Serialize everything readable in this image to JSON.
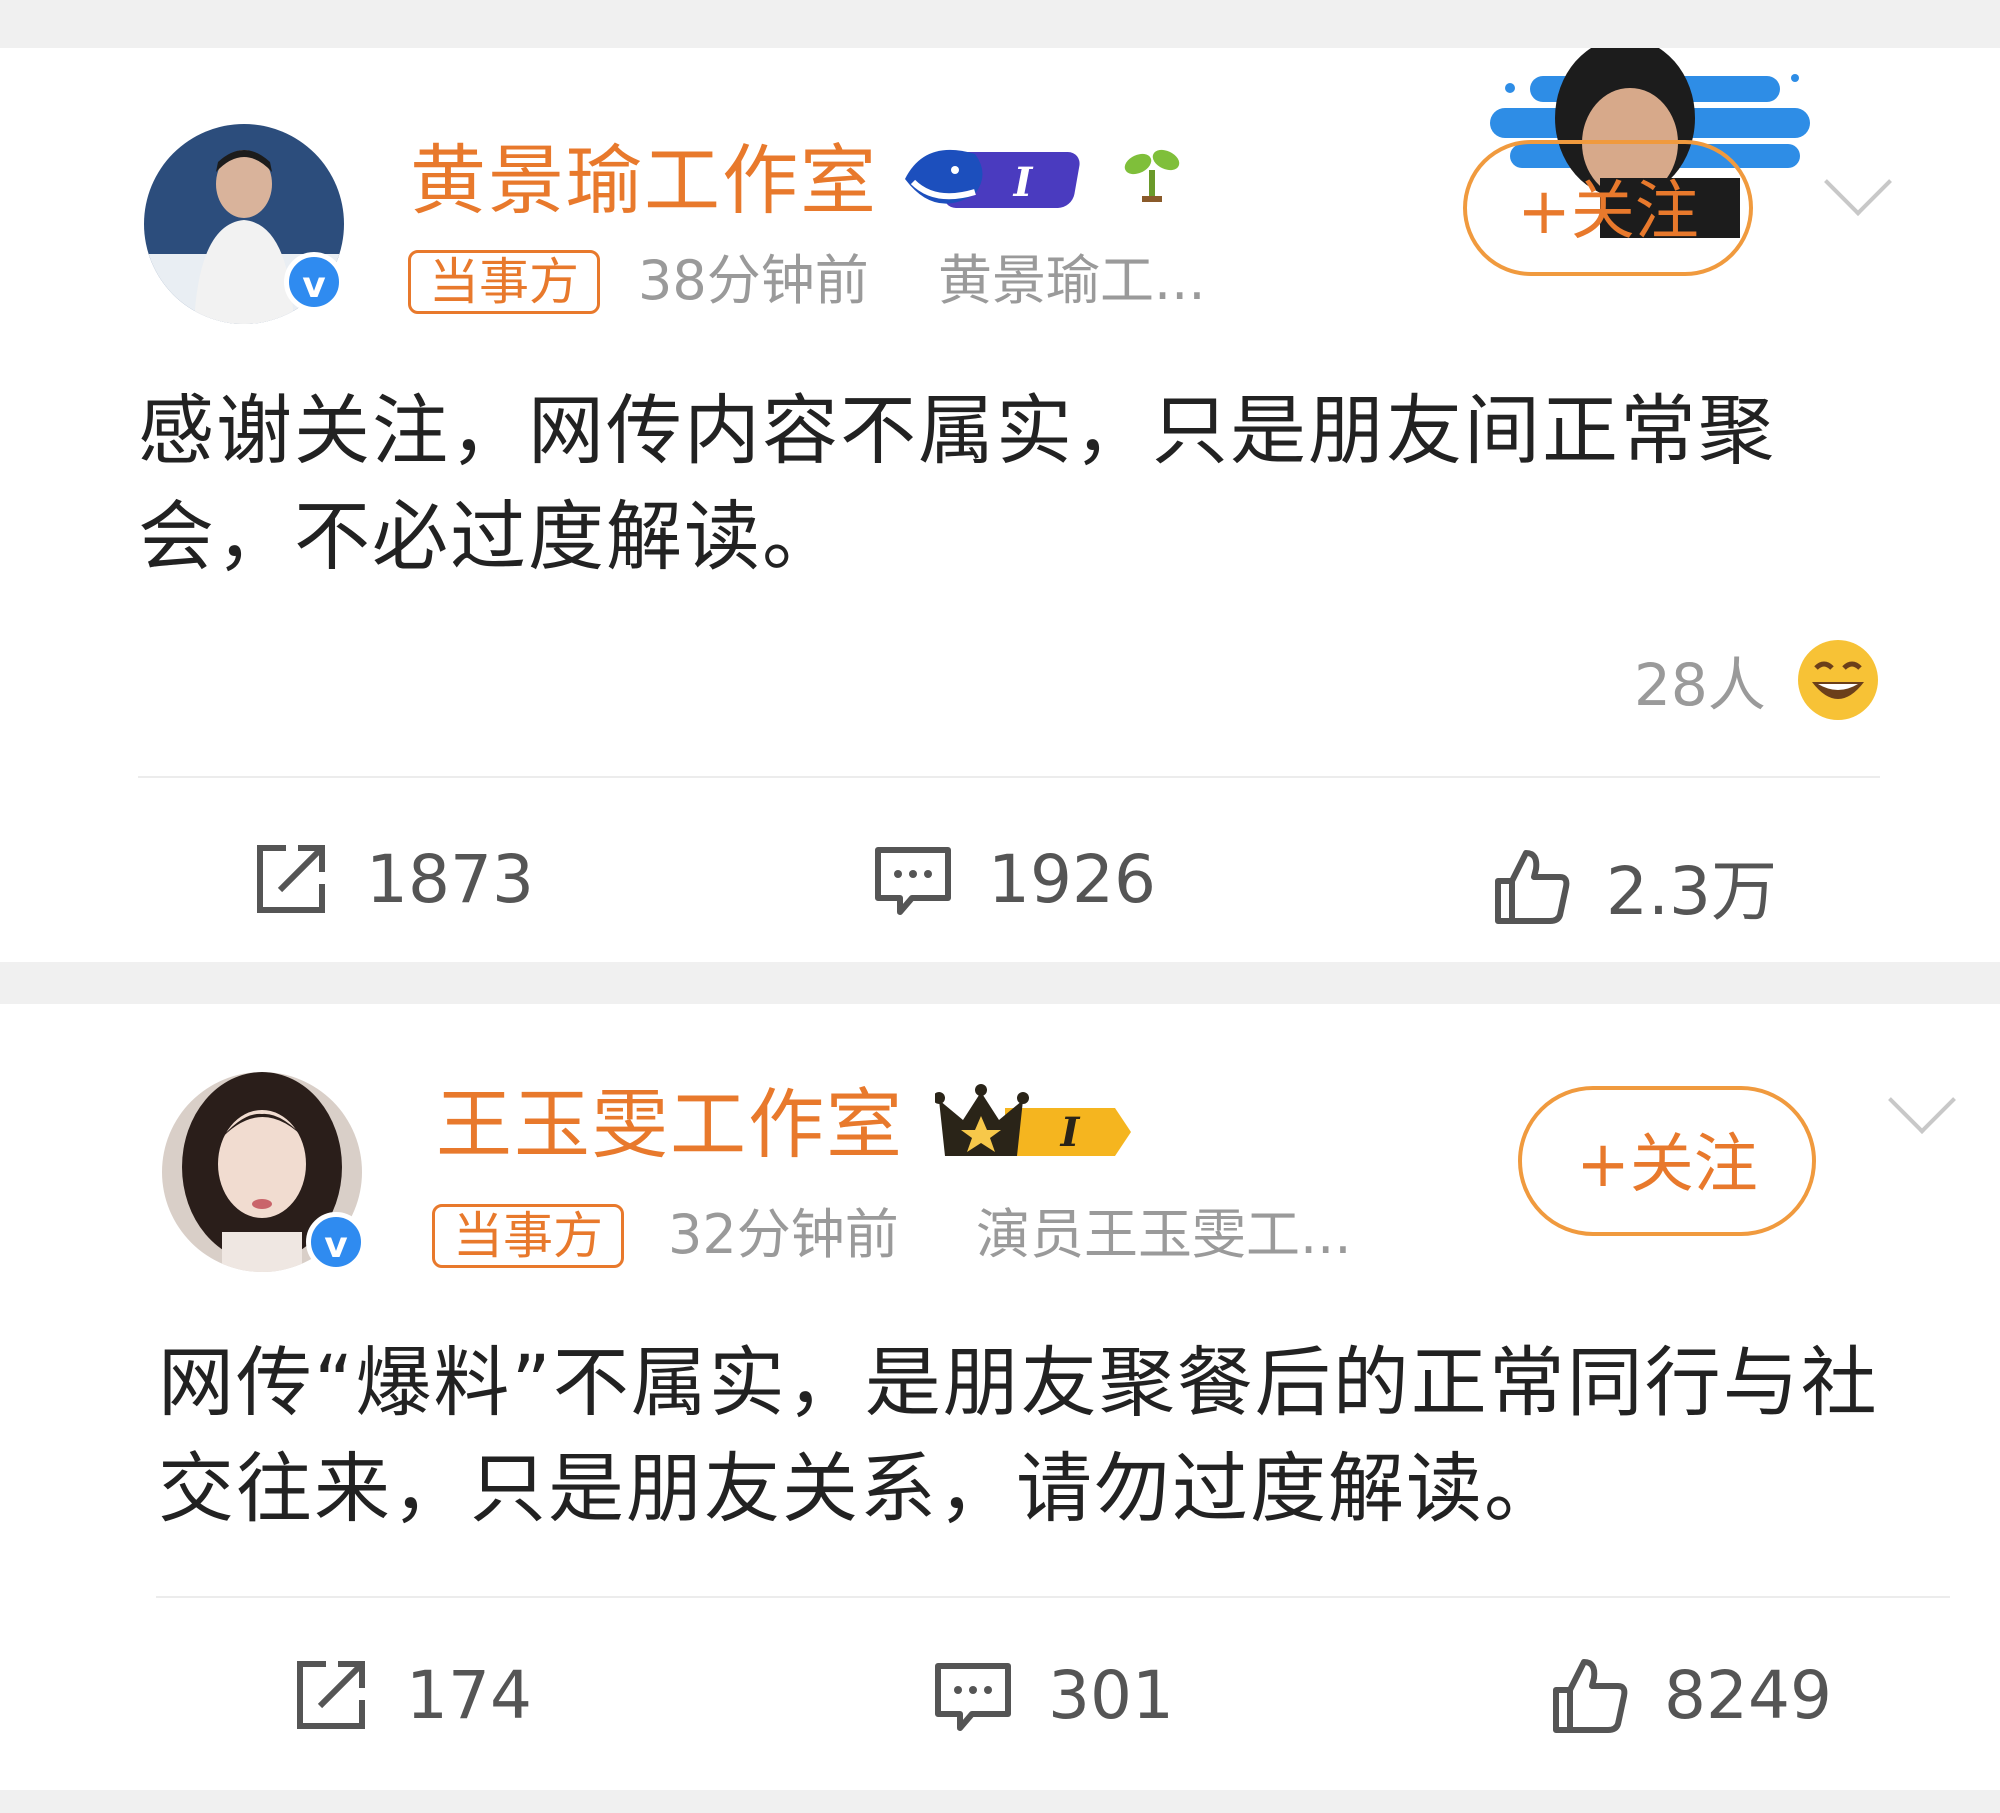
{
  "posts": [
    {
      "author": "黄景瑜工作室",
      "role_tag": "当事方",
      "time": "38分钟前",
      "source": "黄景瑜工...",
      "follow_label": "+关注",
      "content": "感谢关注，网传内容不属实，只是朋友间正常聚会，不必过度解读。",
      "reaction_count": "28人",
      "repost_count": "1873",
      "comment_count": "1926",
      "like_count": "2.3万",
      "badge_level": "I"
    },
    {
      "author": "王玉雯工作室",
      "role_tag": "当事方",
      "time": "32分钟前",
      "source": "演员王玉雯工...",
      "follow_label": "+关注",
      "content": "网传“爆料”不属实，是朋友聚餐后的正常同行与社交往来，只是朋友关系，请勿过度解读。",
      "repost_count": "174",
      "comment_count": "301",
      "like_count": "8249",
      "badge_level": "I"
    }
  ],
  "colors": {
    "accent": "#e8792c",
    "verified": "#2f8bf0",
    "meta_text": "#9a9a9a",
    "background_gap": "#f0f0f0"
  },
  "icons": {
    "verified": "v",
    "repost": "repost-icon",
    "comment": "comment-icon",
    "like": "like-icon",
    "more": "chevron-down-icon"
  }
}
